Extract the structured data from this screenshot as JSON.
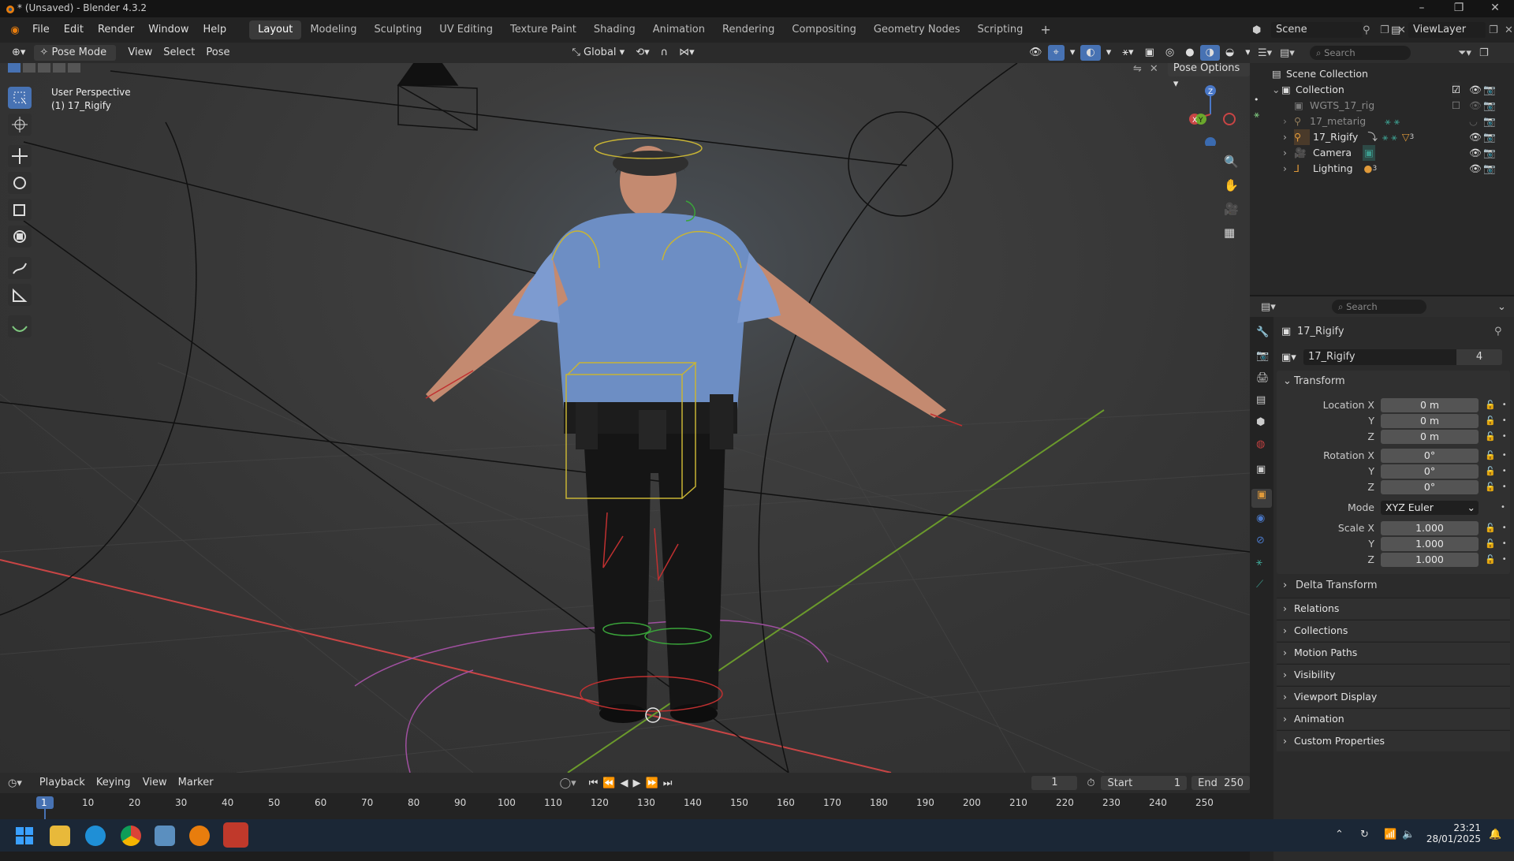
{
  "window": {
    "title": "* (Unsaved) - Blender 4.3.2"
  },
  "menu": {
    "items": [
      "File",
      "Edit",
      "Render",
      "Window",
      "Help"
    ]
  },
  "workspaces": [
    "Layout",
    "Modeling",
    "Sculpting",
    "UV Editing",
    "Texture Paint",
    "Shading",
    "Animation",
    "Rendering",
    "Compositing",
    "Geometry Nodes",
    "Scripting"
  ],
  "active_workspace": "Layout",
  "scene": {
    "name": "Scene",
    "view_layer": "ViewLayer"
  },
  "viewport_header": {
    "mode": "Pose Mode",
    "menus": [
      "View",
      "Select",
      "Pose"
    ],
    "orientation": "Global",
    "pose_options": "Pose Options"
  },
  "viewport": {
    "perspective": "User Perspective",
    "object_label": "(1) 17_Rigify",
    "gizmo": {
      "x": "X",
      "y": "Y",
      "z": "Z"
    }
  },
  "outliner": {
    "search_placeholder": "Search",
    "scene_collection": "Scene Collection",
    "collection": "Collection",
    "items": [
      {
        "name": "WGTS_17_rig"
      },
      {
        "name": "17_metarig"
      },
      {
        "name": "17_Rigify"
      },
      {
        "name": "Camera"
      },
      {
        "name": "Lighting"
      }
    ],
    "badge_rigify": "3",
    "badge_lighting": "3"
  },
  "properties": {
    "search_placeholder": "Search",
    "object_name": "17_Rigify",
    "datablock_name": "17_Rigify",
    "users": "4",
    "transform_title": "Transform",
    "location": {
      "label": "Location X",
      "y": "Y",
      "z": "Z",
      "values": [
        "0 m",
        "0 m",
        "0 m"
      ]
    },
    "rotation": {
      "label": "Rotation X",
      "y": "Y",
      "z": "Z",
      "values": [
        "0°",
        "0°",
        "0°"
      ]
    },
    "mode_label": "Mode",
    "mode_value": "XYZ Euler",
    "scale": {
      "label": "Scale X",
      "y": "Y",
      "z": "Z",
      "values": [
        "1.000",
        "1.000",
        "1.000"
      ]
    },
    "delta_transform": "Delta Transform",
    "sections": [
      "Relations",
      "Collections",
      "Motion Paths",
      "Visibility",
      "Viewport Display",
      "Animation",
      "Custom Properties"
    ]
  },
  "timeline": {
    "menus": [
      "Playback",
      "Keying",
      "View",
      "Marker"
    ],
    "current_frame": "1",
    "start_label": "Start",
    "start": "1",
    "end_label": "End",
    "end": "250",
    "ruler": [
      "1",
      "10",
      "20",
      "30",
      "40",
      "50",
      "60",
      "70",
      "80",
      "90",
      "100",
      "110",
      "120",
      "130",
      "140",
      "150",
      "160",
      "170",
      "180",
      "190",
      "200",
      "210",
      "220",
      "230",
      "240",
      "250"
    ]
  },
  "taskbar": {
    "time": "23:21",
    "date": "28/01/2025"
  }
}
